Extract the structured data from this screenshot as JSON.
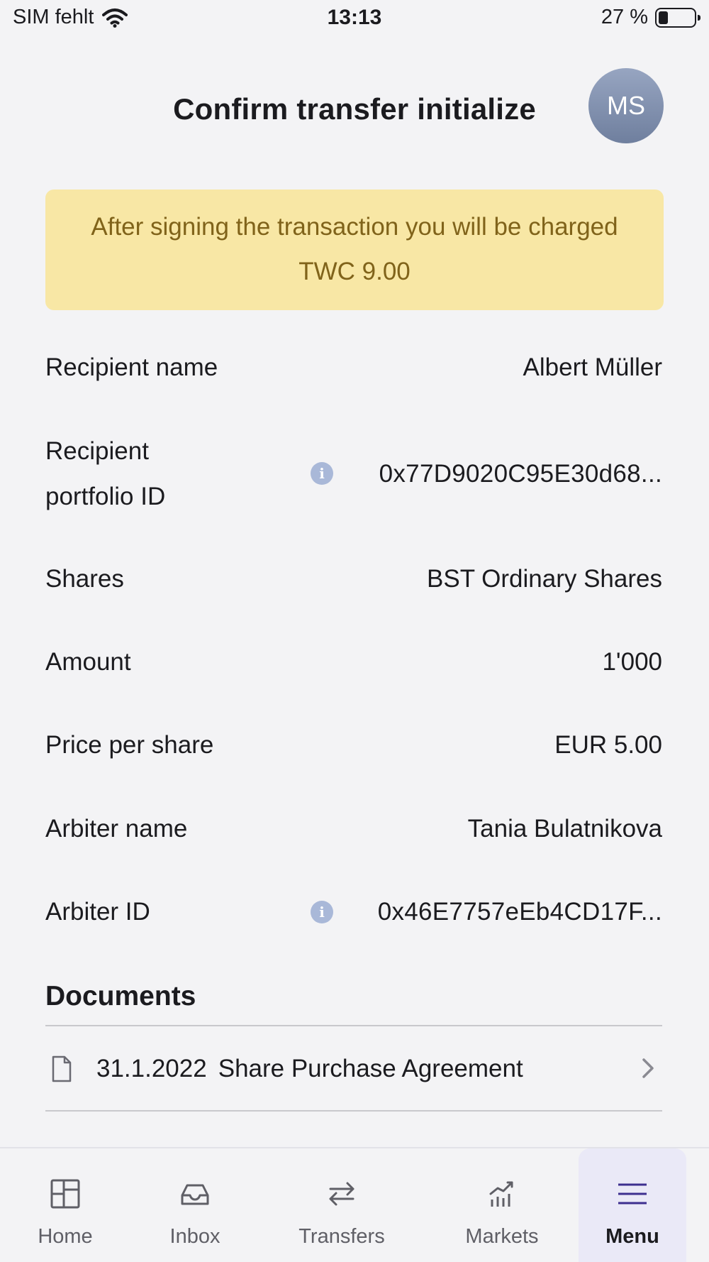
{
  "status_bar": {
    "carrier": "SIM fehlt",
    "time": "13:13",
    "battery": "27 %",
    "battery_level": 0.27,
    "icons": [
      "wifi-icon",
      "battery-icon"
    ]
  },
  "header": {
    "title": "Confirm transfer initialize",
    "avatar_initials": "MS"
  },
  "notice": {
    "line1": "After signing the transaction you will be charged",
    "line2": "TWC 9.00",
    "background": "#f8e7a5",
    "text_color": "#80631a"
  },
  "details": {
    "recipient_name": {
      "label": "Recipient name",
      "value": "Albert Müller"
    },
    "recipient_portfolio": {
      "label_line1": "Recipient",
      "label_line2": "portfolio ID",
      "value": "0x77D9020C95E30d68..."
    },
    "shares": {
      "label": "Shares",
      "value": "BST Ordinary Shares"
    },
    "amount": {
      "label": "Amount",
      "value": "1'000"
    },
    "price_per_share": {
      "label": "Price per share",
      "value": "EUR 5.00"
    },
    "arbiter_name": {
      "label": "Arbiter name",
      "value": "Tania Bulatnikova"
    },
    "arbiter_id": {
      "label": "Arbiter ID",
      "value": "0x46E7757eEb4CD17F..."
    },
    "info_icon": "i"
  },
  "documents": {
    "title": "Documents",
    "items": [
      {
        "date": "31.1.2022",
        "name": "Share Purchase Agreement",
        "icon": "document-icon"
      }
    ]
  },
  "tabbar": {
    "tabs": [
      {
        "label": "Home",
        "icon": "home-grid-icon"
      },
      {
        "label": "Inbox",
        "icon": "inbox-tray-icon"
      },
      {
        "label": "Transfers",
        "icon": "transfer-arrows-icon"
      },
      {
        "label": "Markets",
        "icon": "chart-icon"
      },
      {
        "label": "Menu",
        "icon": "menu-icon",
        "active": true
      }
    ],
    "accent": "#3d2f8f"
  }
}
